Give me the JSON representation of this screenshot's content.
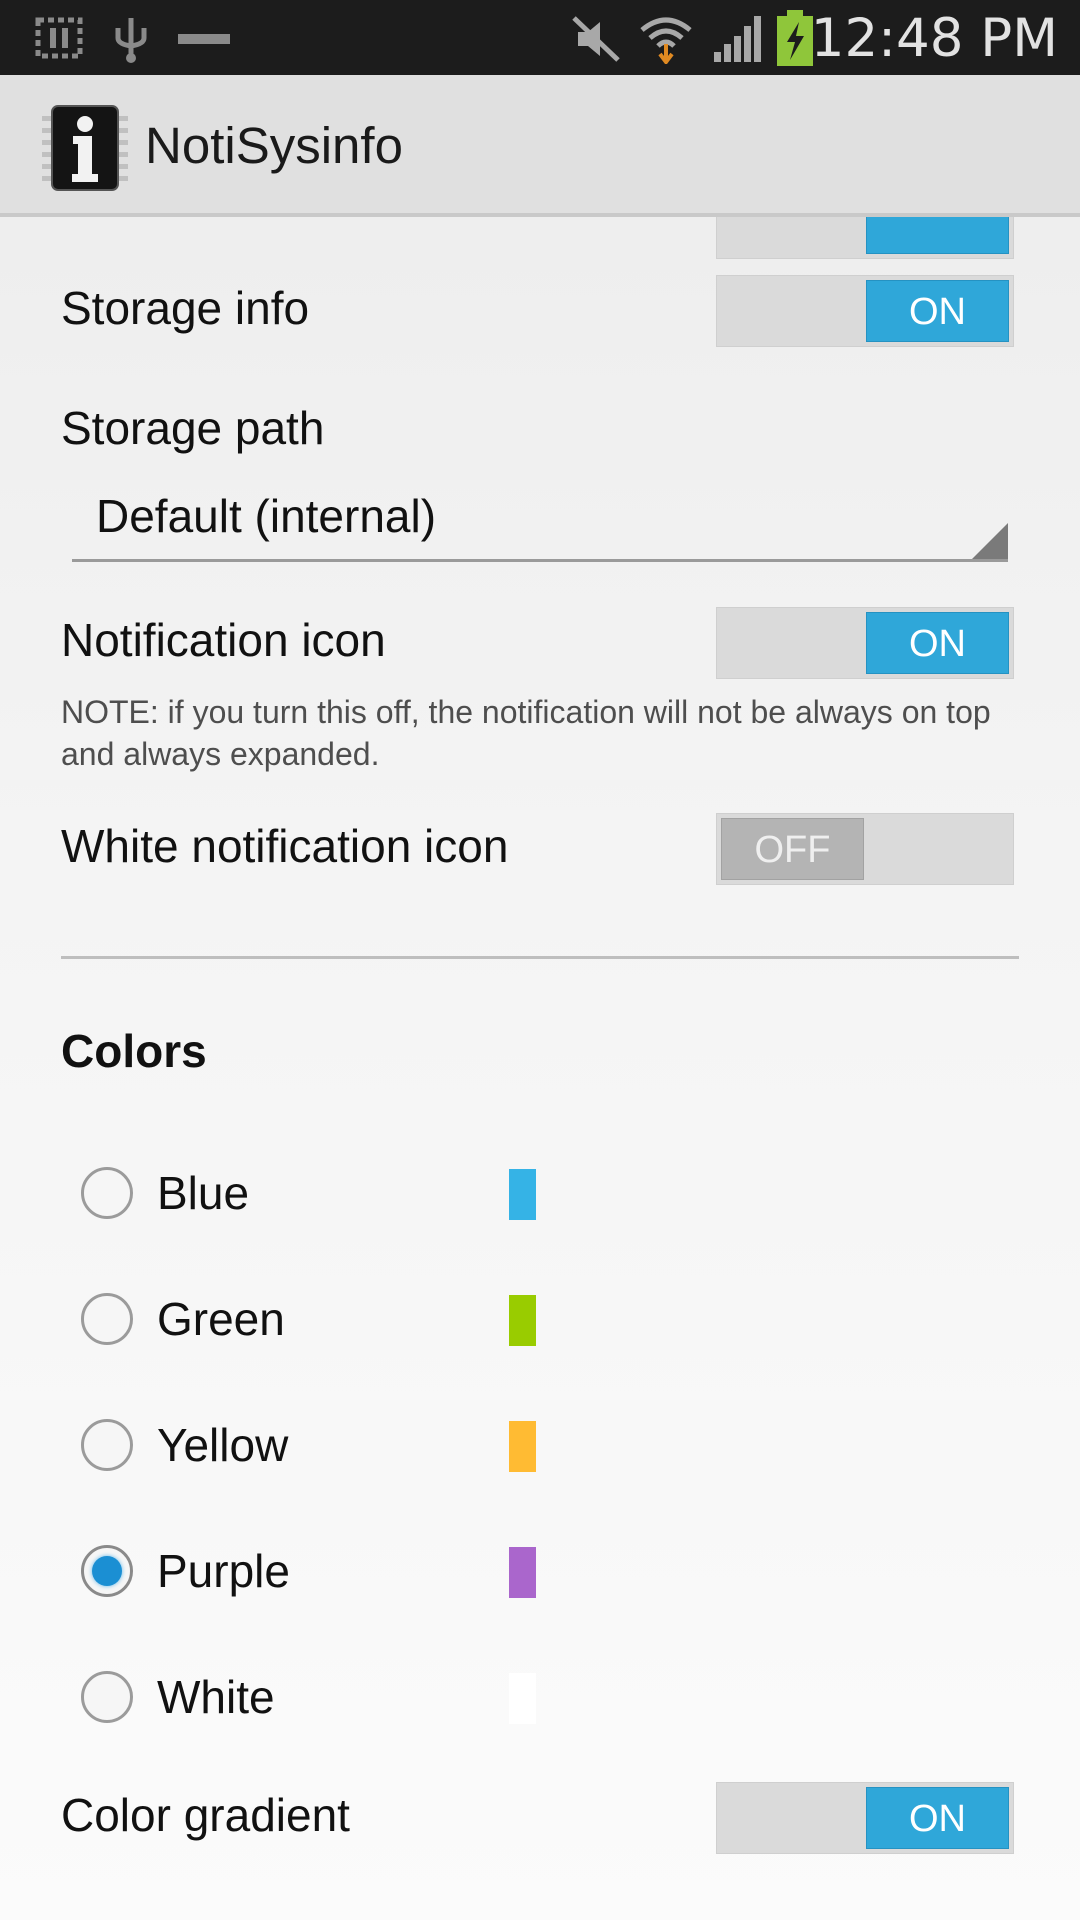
{
  "status_bar": {
    "time": "12:48 PM",
    "icons": [
      "sd-card-icon",
      "usb-icon",
      "minus-icon",
      "mute-icon",
      "wifi-icon",
      "signal-icon",
      "battery-charging-icon"
    ]
  },
  "action_bar": {
    "title": "NotiSysinfo",
    "icon": "info-chip-icon"
  },
  "settings": {
    "storage_info": {
      "title": "Storage info",
      "state": "ON"
    },
    "storage_path": {
      "title": "Storage path",
      "value": "Default (internal)"
    },
    "notification_icon": {
      "title": "Notification icon",
      "state": "ON",
      "summary": "NOTE: if you turn this off, the notification will not be always on top and always expanded."
    },
    "white_notification_icon": {
      "title": "White notification icon",
      "state": "OFF"
    },
    "colors_header": "Colors",
    "colors": [
      {
        "label": "Blue",
        "swatch": "#35b3e6",
        "checked": false
      },
      {
        "label": "Green",
        "swatch": "#99cc00",
        "checked": false
      },
      {
        "label": "Yellow",
        "swatch": "#ffbb33",
        "checked": false
      },
      {
        "label": "Purple",
        "swatch": "#aa66cc",
        "checked": true
      },
      {
        "label": "White",
        "swatch": "#ffffff",
        "checked": false
      }
    ],
    "color_gradient": {
      "title": "Color gradient",
      "state": "ON"
    }
  },
  "theme": {
    "accent": "#2fa7d9",
    "status_bar_bg": "#1c1c1c",
    "action_bar_bg": "#e0e0e0"
  }
}
